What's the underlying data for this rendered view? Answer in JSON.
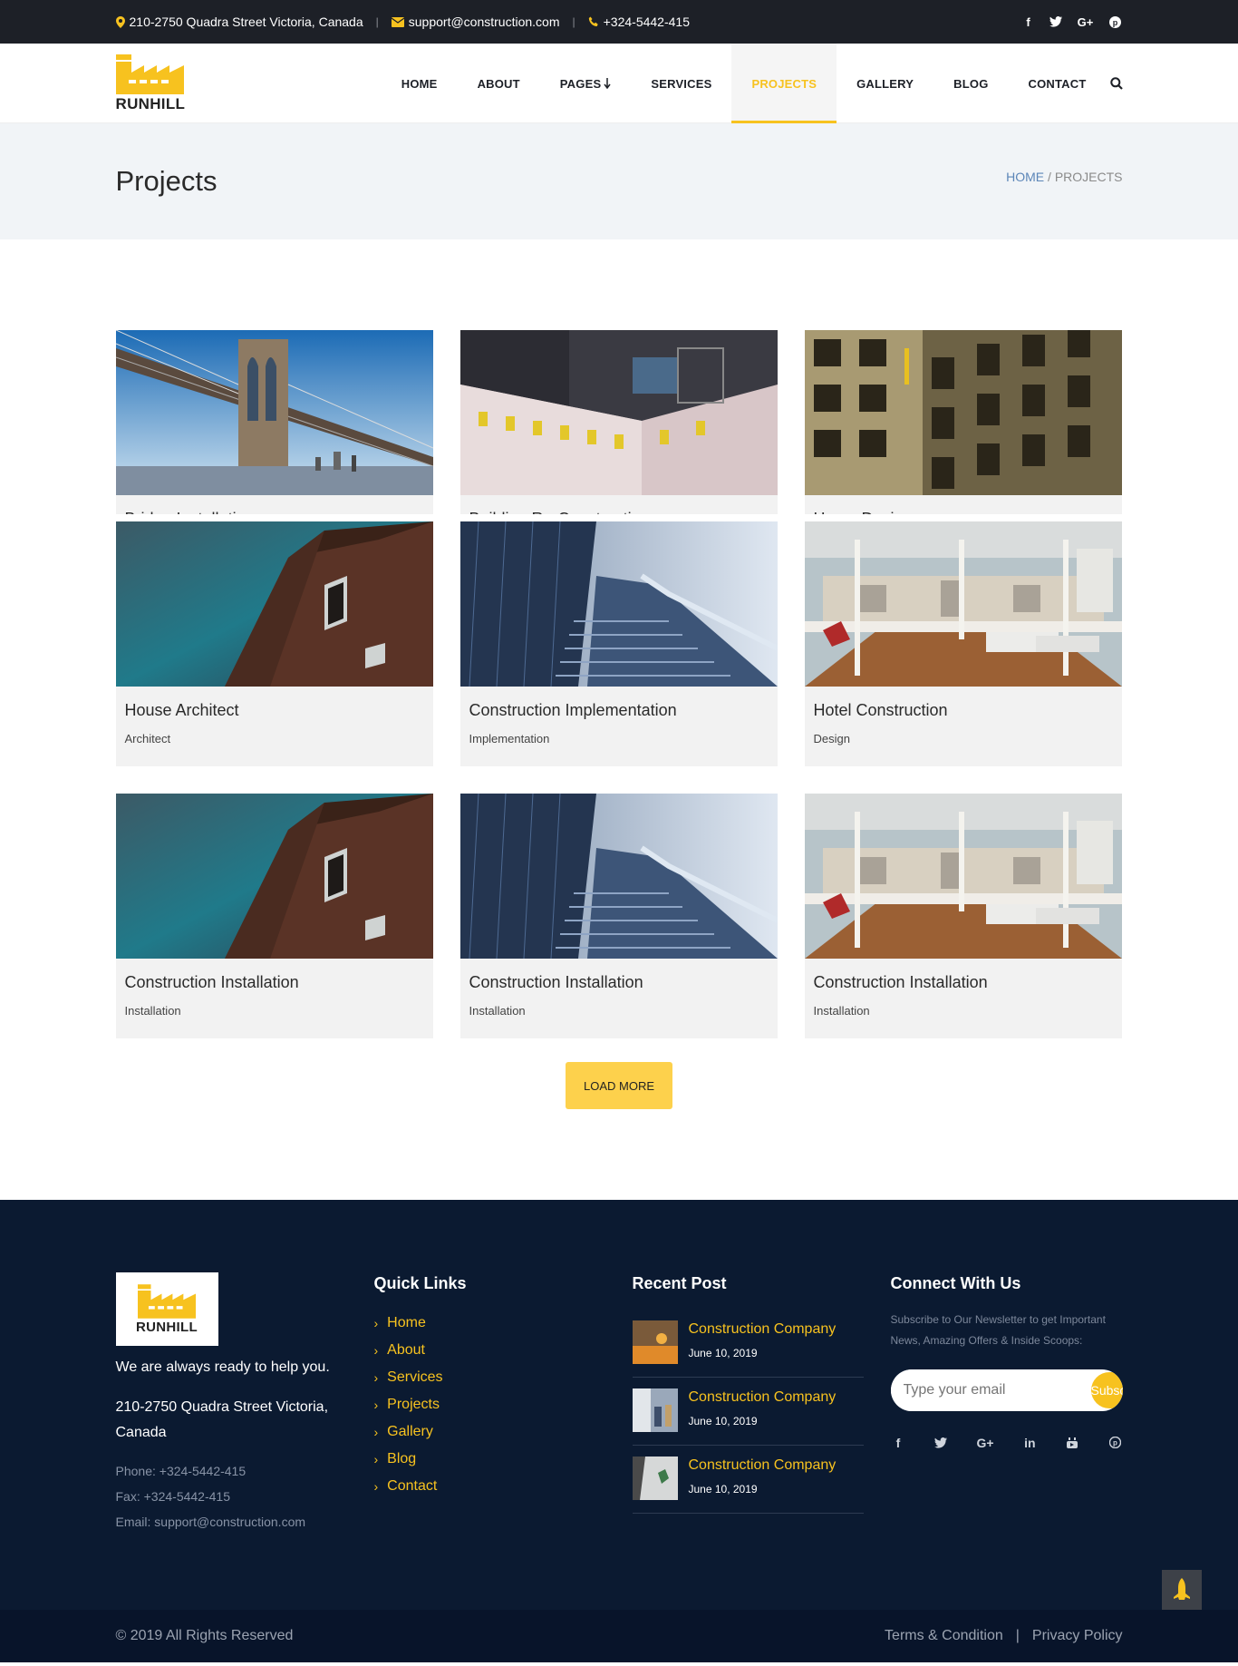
{
  "topbar": {
    "address": "210-2750 Quadra Street Victoria, Canada",
    "email": "support@construction.com",
    "phone": "+324-5442-415",
    "separator": "|",
    "social_icons": [
      "facebook-icon",
      "twitter-icon",
      "google-plus-icon",
      "pinterest-icon"
    ]
  },
  "logo": {
    "text": "RUNHILL"
  },
  "nav": {
    "items": [
      "HOME",
      "ABOUT",
      "PAGES",
      "SERVICES",
      "PROJECTS",
      "GALLERY",
      "BLOG",
      "CONTACT"
    ],
    "active": "PROJECTS"
  },
  "page_title": {
    "heading": "Projects",
    "breadcrumb_home": "HOME",
    "breadcrumb_sep": " / ",
    "breadcrumb_current": "PROJECTS"
  },
  "projects": [
    {
      "title": "Bridge Installation",
      "category": ""
    },
    {
      "title": "Building Re-Construction",
      "category": ""
    },
    {
      "title": "Home Design",
      "category": ""
    },
    {
      "title": "House Architect",
      "category": "Architect"
    },
    {
      "title": "Construction Implementation",
      "category": "Implementation"
    },
    {
      "title": "Hotel Construction",
      "category": "Design"
    },
    {
      "title": "Construction Installation",
      "category": "Installation"
    },
    {
      "title": "Construction Installation",
      "category": "Installation"
    },
    {
      "title": "Construction Installation",
      "category": "Installation"
    }
  ],
  "load_more": "LOAD MORE",
  "footer": {
    "tagline": "We are always ready to help you.",
    "address": "210-2750 Quadra Street Victoria, Canada",
    "phone": "Phone: +324-5442-415",
    "fax": "Fax: +324-5442-415",
    "email": "Email: support@construction.com",
    "quick_links_heading": "Quick Links",
    "quick_links": [
      "Home",
      "About",
      "Services",
      "Projects",
      "Gallery",
      "Blog",
      "Contact"
    ],
    "recent_post_heading": "Recent Post",
    "recent_posts": [
      {
        "title": "Construction Company",
        "date": "June 10, 2019"
      },
      {
        "title": "Construction Company",
        "date": "June 10, 2019"
      },
      {
        "title": "Construction Company",
        "date": "June 10, 2019"
      }
    ],
    "connect_heading": "Connect With Us",
    "newsletter_text": "Subscribe to Our Newsletter to get Important News, Amazing Offers & Inside Scoops:",
    "email_placeholder": "Type your email",
    "subscribe_label": "Subscribe",
    "social_icons": [
      "facebook-icon",
      "twitter-icon",
      "google-plus-icon",
      "linkedin-icon",
      "youtube-icon",
      "pinterest-icon"
    ]
  },
  "bottom": {
    "copyright": "© 2019 All Rights Reserved",
    "terms": "Terms & Condition",
    "separator": "|",
    "privacy": "Privacy Policy"
  },
  "colors": {
    "accent": "#f7c21f",
    "dark": "#1d2027",
    "footer": "#0b1a31"
  }
}
